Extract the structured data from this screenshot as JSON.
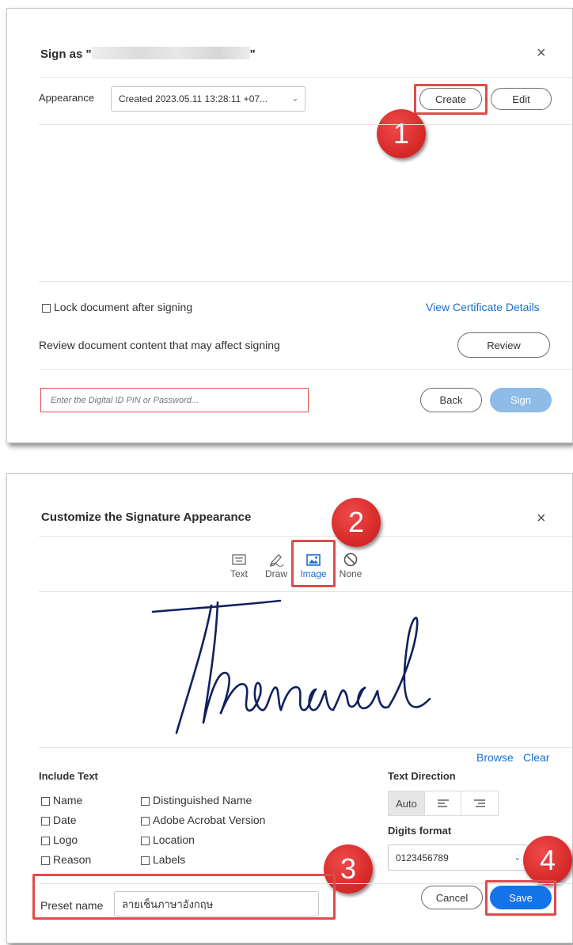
{
  "sign_dialog": {
    "title_prefix": "Sign as \"",
    "title_suffix": "\"",
    "close_glyph": "×",
    "appearance_label": "Appearance",
    "appearance_value": "Created 2023.05.11 13:28:11 +07...",
    "create_label": "Create",
    "edit_label": "Edit",
    "marker_1": "1",
    "lock_label": "Lock document after signing",
    "lock_checked": false,
    "view_cert_link": "View Certificate Details",
    "review_text": "Review document content that may affect signing",
    "review_label": "Review",
    "pin_placeholder": "Enter the Digital ID PIN or Password...",
    "back_label": "Back",
    "sign_label": "Sign"
  },
  "customize_dialog": {
    "title": "Customize the Signature Appearance",
    "close_glyph": "×",
    "marker_2": "2",
    "tabs": [
      {
        "label": "Text",
        "icon": "keyboard-icon",
        "active": false
      },
      {
        "label": "Draw",
        "icon": "pen-icon",
        "active": false
      },
      {
        "label": "Image",
        "icon": "image-icon",
        "active": true
      },
      {
        "label": "None",
        "icon": "none-icon",
        "active": false
      }
    ],
    "browse_link": "Browse",
    "clear_link": "Clear",
    "include_text_heading": "Include Text",
    "include_left": [
      "Name",
      "Date",
      "Logo",
      "Reason"
    ],
    "include_right": [
      "Distinguished Name",
      "Adobe Acrobat Version",
      "Location",
      "Labels"
    ],
    "text_direction_heading": "Text Direction",
    "text_direction_options": [
      "Auto",
      "align-left-icon",
      "align-right-icon"
    ],
    "text_direction_selected": "Auto",
    "digits_heading": "Digits format",
    "digits_value": "0123456789",
    "marker_3": "3",
    "marker_4": "4",
    "preset_label": "Preset name",
    "preset_value": "ลายเซ็นภาษาอังกฤษ",
    "cancel_label": "Cancel",
    "save_label": "Save"
  },
  "colors": {
    "accent": "#1473e6",
    "disabled_accent": "#8fbce6",
    "highlight_red": "#e04b4b",
    "marker_red": "#d42727",
    "link_blue": "#1a6fc9",
    "signature_ink": "#12205e"
  }
}
